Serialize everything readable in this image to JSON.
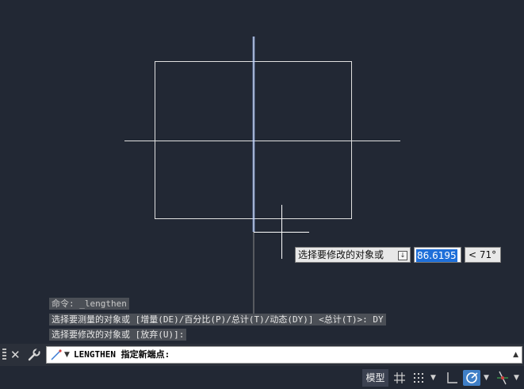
{
  "viewport": {
    "drawing_color": "#e0e0e0",
    "selected_line_color": "#3a7bd5",
    "crosshair_color": "#ffffff"
  },
  "dynamic_input": {
    "prompt": "选择要修改的对象或",
    "download_icon": "down-arrow-icon",
    "length_value": "86.6195",
    "angle_value": "< 71°"
  },
  "command_history": [
    "命令: _lengthen",
    "选择要测量的对象或 [增量(DE)/百分比(P)/总计(T)/动态(DY)] <总计(T)>: DY",
    "选择要修改的对象或 [放弃(U)]:"
  ],
  "command_line": {
    "text": "LENGTHEN 指定新端点:",
    "icons": [
      "grip-icon",
      "close-icon",
      "wrench-icon",
      "line-command-icon",
      "chevron-down-icon",
      "chevron-up-icon"
    ]
  },
  "status_bar": {
    "model_tab": "模型",
    "icons": [
      "grid-icon",
      "snap-icon",
      "ortho-icon",
      "polar-tracking-icon",
      "object-snap-icon"
    ],
    "accent": "#3f7fc7"
  }
}
